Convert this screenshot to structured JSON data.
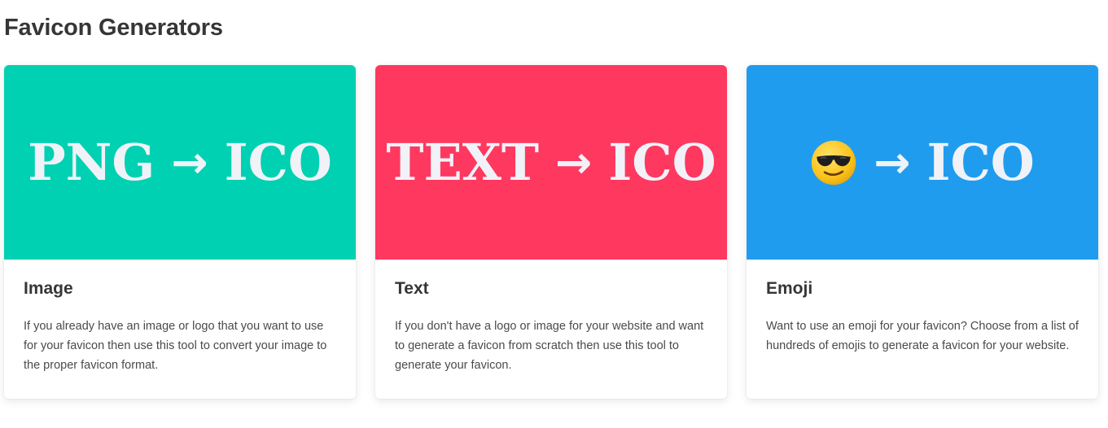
{
  "section": {
    "title": "Favicon Generators"
  },
  "cards": [
    {
      "banner_from": "PNG",
      "banner_arrow": "→",
      "banner_to": "ICO",
      "banner_color": "#00d1b2",
      "title": "Image",
      "description": "If you already have an image or logo that you want to use for your favicon then use this tool to convert your image to the proper favicon format."
    },
    {
      "banner_from": "TEXT",
      "banner_arrow": "→",
      "banner_to": "ICO",
      "banner_color": "#ff3860",
      "title": "Text",
      "description": "If you don't have a logo or image for your website and want to generate a favicon from scratch then use this tool to generate your favicon."
    },
    {
      "banner_from_icon": "sunglasses-emoji-icon",
      "banner_arrow": "→",
      "banner_to": "ICO",
      "banner_color": "#209cee",
      "title": "Emoji",
      "description": "Want to use an emoji for your favicon? Choose from a list of hundreds of emojis to generate a favicon for your website."
    }
  ],
  "colors": {
    "banner_text": "#f0f2f8",
    "heading_text": "#363636",
    "body_text": "#4a4a4a"
  }
}
